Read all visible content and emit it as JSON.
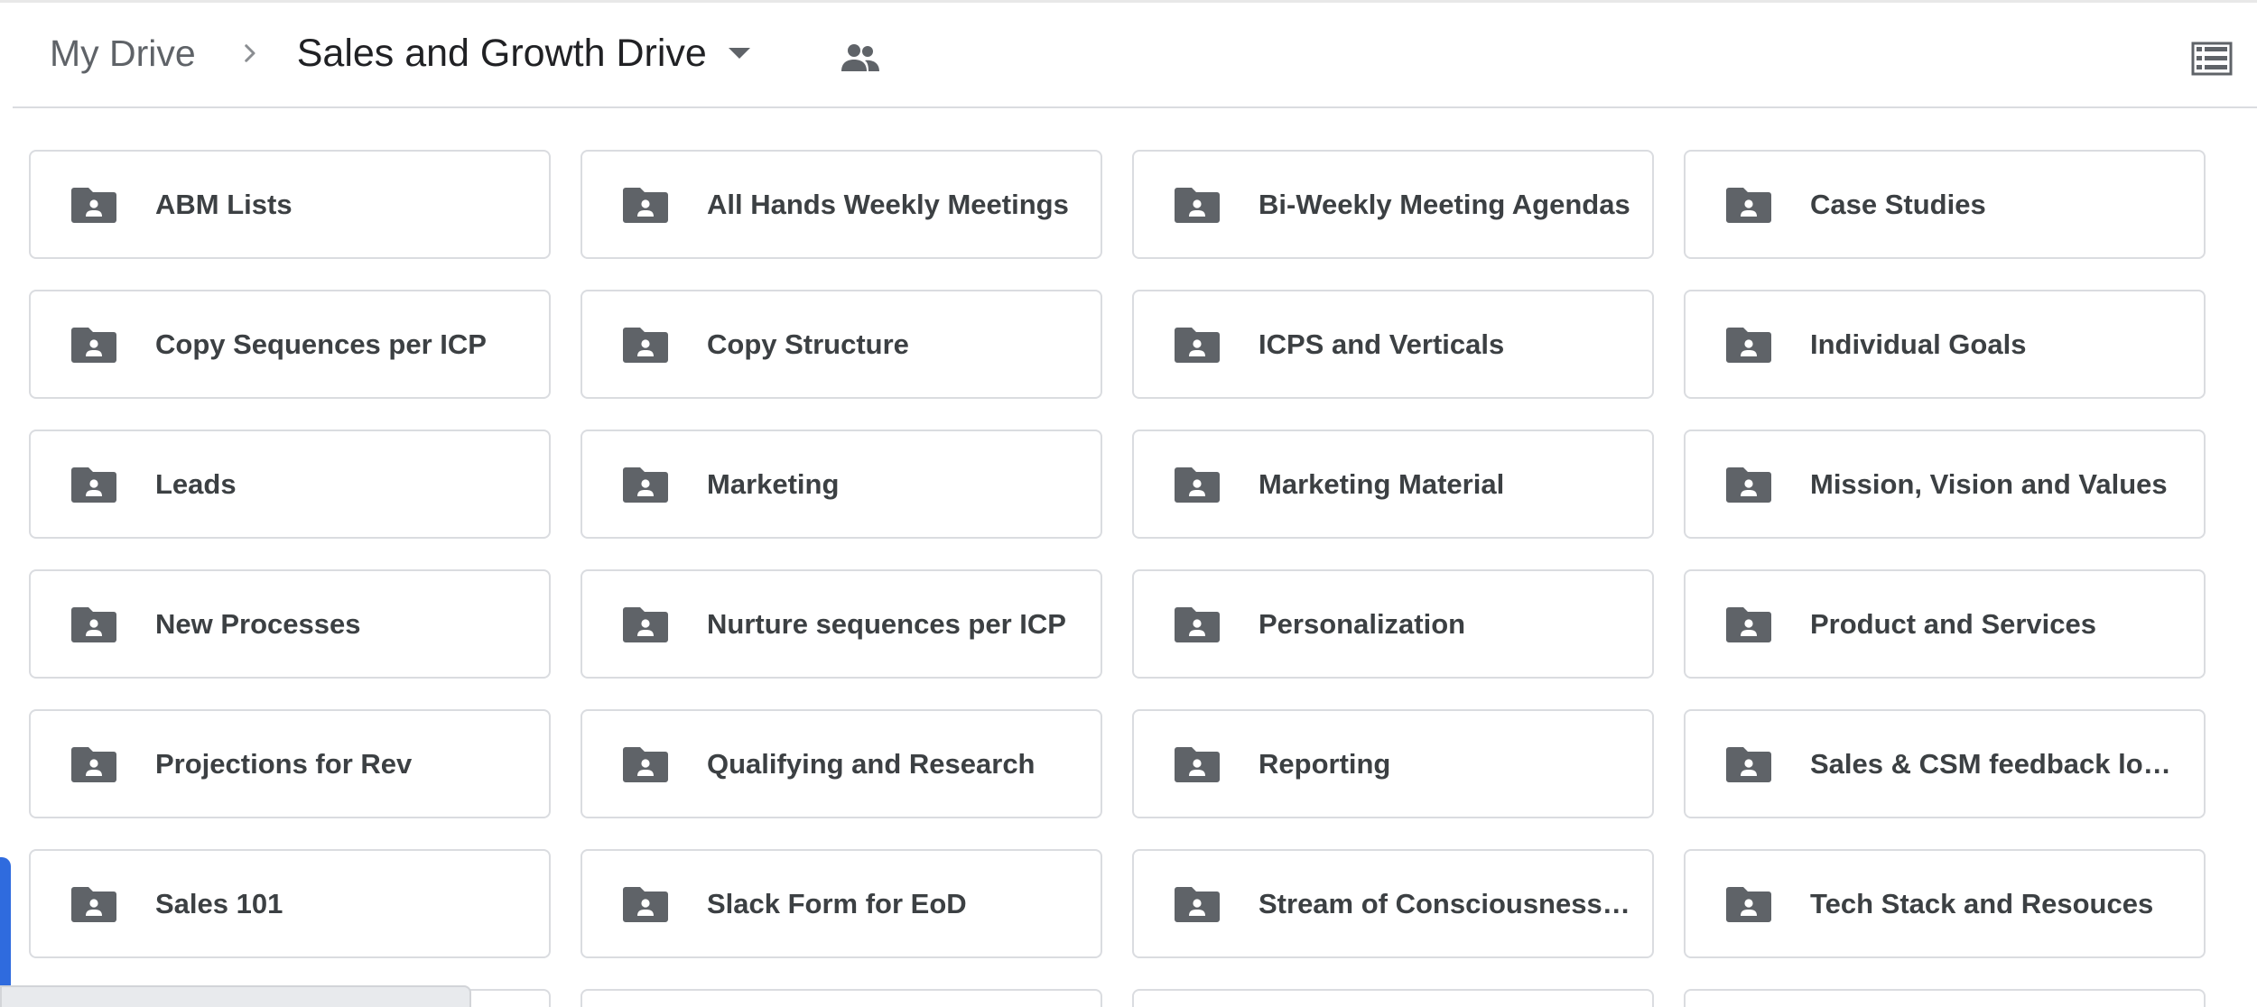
{
  "breadcrumb": {
    "root": "My Drive",
    "current": "Sales and Growth Drive"
  },
  "icons": {
    "separator": "chevron-right-icon",
    "dropdown": "arrow-drop-down-icon",
    "shared": "people-icon",
    "view_toggle": "list-view-icon",
    "folder": "shared-folder-icon"
  },
  "colors": {
    "folder_icon": "#5f6368",
    "label_text": "#3c4043",
    "border": "#dadce0",
    "accent_tab": "#2f6bde"
  },
  "folders": [
    {
      "label": "ABM Lists"
    },
    {
      "label": "All Hands Weekly Meetings"
    },
    {
      "label": "Bi-Weekly Meeting Agendas"
    },
    {
      "label": "Case Studies"
    },
    {
      "label": "Copy Sequences per ICP"
    },
    {
      "label": "Copy Structure"
    },
    {
      "label": "ICPS and Verticals"
    },
    {
      "label": "Individual Goals"
    },
    {
      "label": "Leads"
    },
    {
      "label": "Marketing"
    },
    {
      "label": "Marketing Material"
    },
    {
      "label": "Mission, Vision and Values"
    },
    {
      "label": "New Processes"
    },
    {
      "label": "Nurture sequences per ICP"
    },
    {
      "label": "Personalization"
    },
    {
      "label": "Product and Services"
    },
    {
      "label": "Projections for Rev"
    },
    {
      "label": "Qualifying and Research"
    },
    {
      "label": "Reporting"
    },
    {
      "label": "Sales & CSM feedback loo..."
    },
    {
      "label": "Sales 101"
    },
    {
      "label": "Slack Form for EoD"
    },
    {
      "label": "Stream of Consciousness ..."
    },
    {
      "label": "Tech Stack and Resouces"
    }
  ]
}
